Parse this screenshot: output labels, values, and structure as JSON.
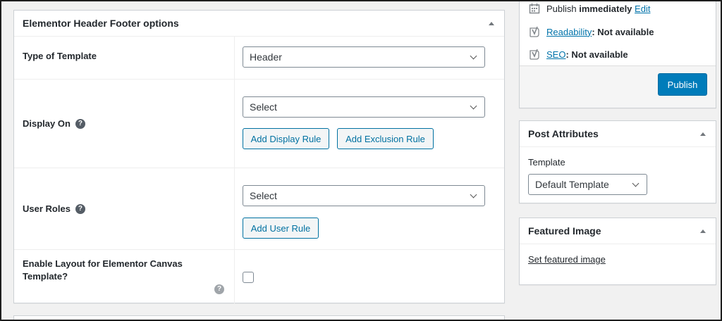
{
  "options_box": {
    "title": "Elementor Header Footer options",
    "rows": {
      "template_type": {
        "label": "Type of Template",
        "select_value": "Header"
      },
      "display_on": {
        "label": "Display On",
        "select_value": "Select",
        "add_display_rule": "Add Display Rule",
        "add_exclusion_rule": "Add Exclusion Rule"
      },
      "user_roles": {
        "label": "User Roles",
        "select_value": "Select",
        "add_user_rule": "Add User Rule"
      },
      "canvas_layout": {
        "label": "Enable Layout for Elementor Canvas Template?",
        "checked": false
      }
    }
  },
  "publish_box": {
    "publish_text": "Publish",
    "publish_when": "immediately",
    "edit_link": "Edit",
    "readability_link": "Readability",
    "readability_status": ": Not available",
    "seo_link": "SEO",
    "seo_status": ": Not available",
    "publish_button": "Publish"
  },
  "attributes_box": {
    "title": "Post Attributes",
    "template_label": "Template",
    "template_value": "Default Template"
  },
  "featured_box": {
    "title": "Featured Image",
    "set_link": "Set featured image"
  },
  "colors": {
    "primary": "#007cba",
    "link": "#0073aa",
    "secondary_button_text": "#0071a1"
  }
}
